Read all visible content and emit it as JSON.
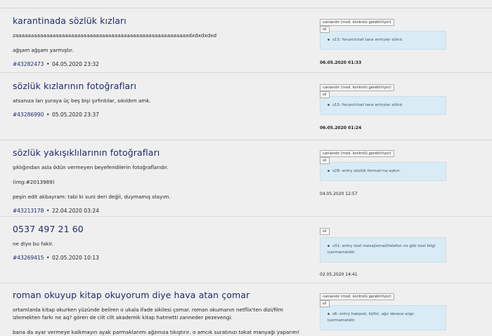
{
  "entries": [
    {
      "title": "karantinada sözlük kızları",
      "paragraphs": [
        "zaaaaaaaaaaaaaaaaaaaaaaaaaaaaaaaaaaaaaaaaaaaaaaaaaaaaaaaxdxdxdxdxd",
        "ağşam ağşam yarmıştır."
      ],
      "id": "#43282473",
      "date": "04.05.2020 23:32",
      "buttons": [
        "canlandır (mod. kontrolü gerektiriyor)",
        "sil"
      ],
      "reason": "s15: forum/chat tarzı entryler silinir.",
      "mod_date": "06.05.2020 01:33",
      "mod_date_bold": true
    },
    {
      "title": "sözlük kızlarının fotoğrafları",
      "paragraphs": [
        "atsanıza lan şuraya üç beş bişi şırfıntılar, sıkıldım amk."
      ],
      "id": "#43286990",
      "date": "05.05.2020 23:37",
      "buttons": [
        "canlandır (mod. kontrolü gerektiriyor)",
        "sil"
      ],
      "reason": "s15: forum/chat tarzı entryler silinir.",
      "mod_date": "06.05.2020 01:24",
      "mod_date_bold": true
    },
    {
      "title": "sözlük yakışıklılarının fotoğrafları",
      "paragraphs": [
        "şıklığından asla ödün vermeyen beyefendilerin fotoğraflarıdır.",
        "(img:#2013989)",
        "peşin edit akbayram: tabi ki suni deri değil, duymamış olayım."
      ],
      "id": "#43213178",
      "date": "22.04.2020 03:24",
      "buttons": [
        "canlandır (mod. kontrolü gerektiriyor)",
        "sil"
      ],
      "reason": "s28: entry sözlük formatı'na aykırı.",
      "mod_date": "04.05.2020 12:57",
      "mod_date_bold": false
    },
    {
      "title": "0537 497 21 60",
      "paragraphs": [
        "ne diyo bu fakir."
      ],
      "id": "#43269415",
      "date": "02.05.2020 10:13",
      "buttons": [
        "sil"
      ],
      "reason": "s31: entry özel mesaj/email/telefon no gibi özel bilgi içermemelidir.",
      "mod_date": "02.05.2020 14:41",
      "mod_date_bold": false
    },
    {
      "title": "roman okuyup kitap okuyorum diye hava atan çomar",
      "paragraphs": [
        "ortamlarda kitap okurken yüzünde beliren o ukala ifade sikilesi çomar. roman okumanın netflix'ten dizi/film izlemekten farkı ne aq? gören de cilt cilt akademik kitap hatmetti zanneder pezevengi.",
        "bana da ayar vermeye kalkmayın ayak parmaklarımı ağzınıza tıkıştırır, o amcık suratınızı tokat manyağı yaparım!"
      ],
      "id": "",
      "date": "",
      "buttons": [
        "canlandır (mod. kontrolü gerektiriyor)",
        "sil"
      ],
      "reason": "s6: entry hakaret, küfür, ağır derece argo içermemelidir.",
      "mod_date": "",
      "mod_date_bold": false
    }
  ]
}
